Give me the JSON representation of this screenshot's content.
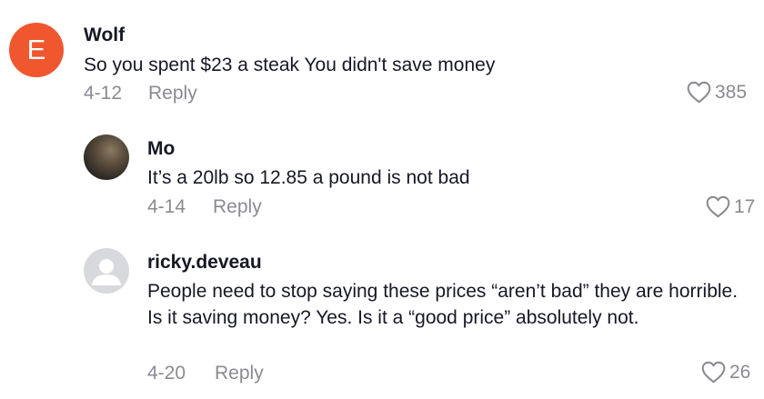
{
  "comments": [
    {
      "avatar_letter": "E",
      "username": "Wolf",
      "text": "So you spent $23 a steak You didn't save money",
      "date": "4-12",
      "reply_label": "Reply",
      "likes": "385"
    },
    {
      "username": "Mo",
      "text": "It’s a 20lb so 12.85 a pound is not bad",
      "date": "4-14",
      "reply_label": "Reply",
      "likes": "17"
    },
    {
      "username": "ricky.deveau",
      "text": "People need to stop saying these prices “aren’t bad” they are horrible. Is it saving money? Yes. Is it a “good price” absolutely not.",
      "date": "4-20",
      "reply_label": "Reply",
      "likes": "26"
    }
  ],
  "icons": {
    "like": "heart-outline-icon",
    "default_avatar": "user-silhouette-icon"
  },
  "colors": {
    "avatar_letter_bg": "#f0572f",
    "meta_text": "#8a8b91",
    "primary_text": "#161823"
  }
}
